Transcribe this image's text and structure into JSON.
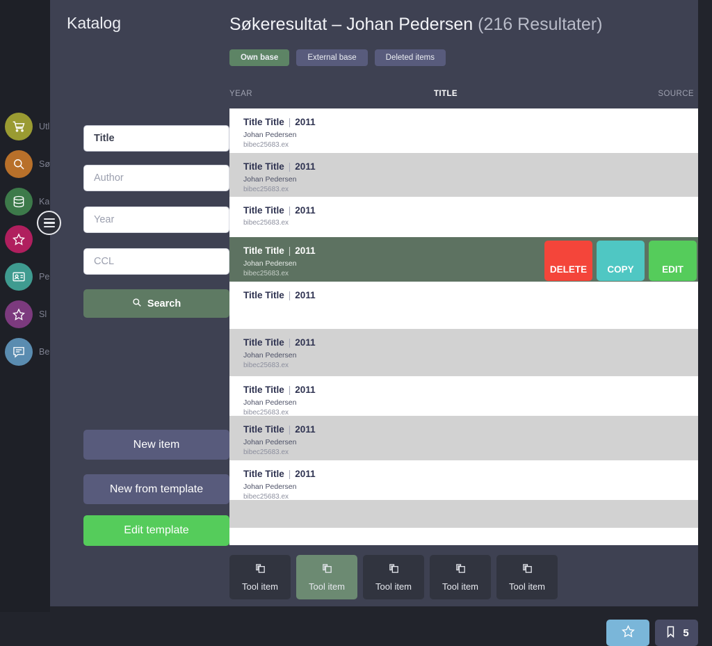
{
  "app": {
    "katalog_label": "Katalog"
  },
  "rail": {
    "items": [
      {
        "label": "Utl",
        "icon": "cart-icon",
        "color": "#9a9b32"
      },
      {
        "label": "Sø",
        "icon": "search-icon",
        "color": "#b8702a"
      },
      {
        "label": "Ka",
        "icon": "database-icon",
        "color": "#3d7a4a"
      },
      {
        "label": "",
        "icon": "star-icon",
        "color": "#b01f5e"
      },
      {
        "label": "Pe",
        "icon": "id-card-icon",
        "color": "#3f9b90"
      },
      {
        "label": "Sl",
        "icon": "star-icon",
        "color": "#7c3a7e"
      },
      {
        "label": "Be",
        "icon": "chat-icon",
        "color": "#5a8cb0"
      }
    ],
    "menu_toggle": "menu-icon"
  },
  "search_form": {
    "fields": [
      {
        "name": "title",
        "value": "Title",
        "placeholder": "Title",
        "filled": true
      },
      {
        "name": "author",
        "value": "Author",
        "placeholder": "Author",
        "filled": false
      },
      {
        "name": "year",
        "value": "Year",
        "placeholder": "Year",
        "filled": false
      },
      {
        "name": "ccl",
        "value": "CCL",
        "placeholder": "CCL",
        "filled": false
      }
    ],
    "search_label": "Search"
  },
  "side_actions": {
    "new_item": "New item",
    "new_from_template": "New from template",
    "edit_template": "Edit template"
  },
  "header": {
    "title": "Søkeresultat – Johan Pedersen",
    "count": "(216 Resultater)",
    "tabs": [
      {
        "label": "Own base",
        "active": true
      },
      {
        "label": "External base",
        "active": false
      },
      {
        "label": "Deleted items",
        "active": false
      }
    ]
  },
  "table": {
    "columns": {
      "year": "YEAR",
      "title": "TITLE",
      "source": "SOURCE"
    },
    "rows": [
      {
        "title": "Title Title",
        "year": "2011",
        "author": "Johan Pedersen",
        "source": "bibec25683.ex",
        "style": "white",
        "selected": false
      },
      {
        "title": "Title Title",
        "year": "2011",
        "author": "Johan Pedersen",
        "source": "bibec25683.ex",
        "style": "alt",
        "selected": false
      },
      {
        "title": "Title Title",
        "year": "2011",
        "author": "",
        "source": "bibec25683.ex",
        "style": "white",
        "selected": false
      },
      {
        "title": "Title Title",
        "year": "2011",
        "author": "Johan Pedersen",
        "source": "bibec25683.ex",
        "style": "selected",
        "selected": true
      },
      {
        "title": "Title Title",
        "year": "2011",
        "author": "",
        "source": "",
        "style": "white",
        "selected": false
      },
      {
        "title": "Title Title",
        "year": "2011",
        "author": "Johan Pedersen",
        "source": "bibec25683.ex",
        "style": "alt",
        "selected": false
      },
      {
        "title": "Title Title",
        "year": "2011",
        "author": "Johan Pedersen",
        "source": "bibec25683.ex",
        "style": "white",
        "selected": false
      },
      {
        "title": "Title Title",
        "year": "2011",
        "author": "Johan Pedersen",
        "source": "bibec25683.ex",
        "style": "alt",
        "selected": false
      },
      {
        "title": "Title Title",
        "year": "2011",
        "author": "Johan Pedersen",
        "source": "bibec25683.ex",
        "style": "white",
        "selected": false
      },
      {
        "title": "",
        "year": "",
        "author": "",
        "source": "",
        "style": "alt",
        "selected": false
      }
    ],
    "row_actions": {
      "delete": "DELETE",
      "copy": "COPY",
      "edit": "EDIT"
    }
  },
  "toolbar": {
    "items": [
      {
        "label": "Tool item",
        "active": false
      },
      {
        "label": "Tool item",
        "active": true
      },
      {
        "label": "Tool item",
        "active": false
      },
      {
        "label": "Tool item",
        "active": false
      },
      {
        "label": "Tool item",
        "active": false
      }
    ]
  },
  "fabs": {
    "star_icon": "star-icon",
    "bookmark_icon": "bookmark-icon",
    "bookmark_count": "5"
  }
}
